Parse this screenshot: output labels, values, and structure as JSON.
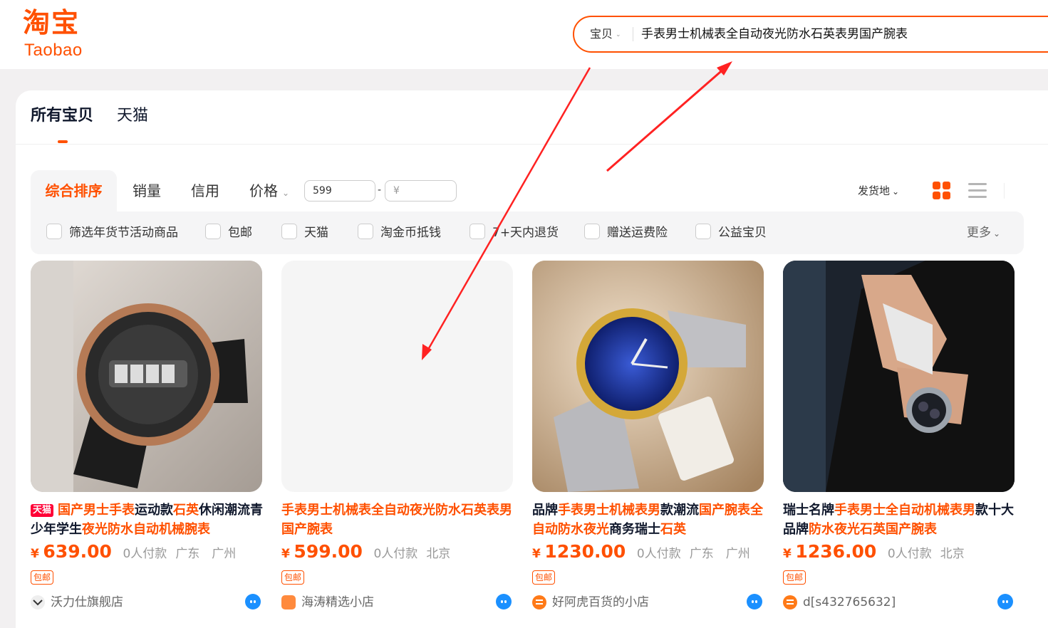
{
  "header": {
    "logo_cn": "淘宝",
    "logo_en": "Taobao",
    "search_category": "宝贝",
    "search_query": "手表男士机械表全自动夜光防水石英表男国产腕表"
  },
  "tabs": [
    {
      "label": "所有宝贝",
      "active": true
    },
    {
      "label": "天猫",
      "active": false
    }
  ],
  "sort": {
    "comprehensive": "综合排序",
    "sales": "销量",
    "credit": "信用",
    "price": "价格",
    "price_min": "599",
    "price_max_placeholder": "¥",
    "price_dash": "-",
    "ship_from": "发货地"
  },
  "filters": [
    "筛选年货节活动商品",
    "包邮",
    "天猫",
    "淘金币抵钱",
    "7+天内退货",
    "赠送运费险",
    "公益宝贝"
  ],
  "more_label": "更多",
  "accent_color": "#ff5000",
  "products": [
    {
      "tag": "天猫",
      "title_parts": [
        "国产男士手表",
        "运动款",
        "石英",
        "休闲潮流青少年学生",
        "夜光防水自动机械腕表"
      ],
      "currency": "¥",
      "price": "639.00",
      "sold": "0人付款",
      "location": "广东　广州",
      "free_shipping": "包邮",
      "shop": "沃力仕旗舰店"
    },
    {
      "title_parts": [
        "手表男士机械表全自动夜光防水石英表男国产腕表"
      ],
      "currency": "¥",
      "price": "599.00",
      "sold": "0人付款",
      "location": "北京",
      "free_shipping": "包邮",
      "shop": "海涛精选小店"
    },
    {
      "title_parts": [
        "品牌",
        "手表男士机械表男",
        "款潮流",
        "国产腕表全自动防水夜光",
        "商务瑞士",
        "石英"
      ],
      "currency": "¥",
      "price": "1230.00",
      "sold": "0人付款",
      "location": "广东　广州",
      "free_shipping": "包邮",
      "shop": "好阿虎百货的小店"
    },
    {
      "title_parts": [
        "瑞士名牌",
        "手表男士全自动机械表男",
        "款十大品牌",
        "防水夜光石英",
        "国产腕表"
      ],
      "currency": "¥",
      "price": "1236.00",
      "sold": "0人付款",
      "location": "北京",
      "free_shipping": "包邮",
      "shop": "d[s432765632]"
    }
  ]
}
